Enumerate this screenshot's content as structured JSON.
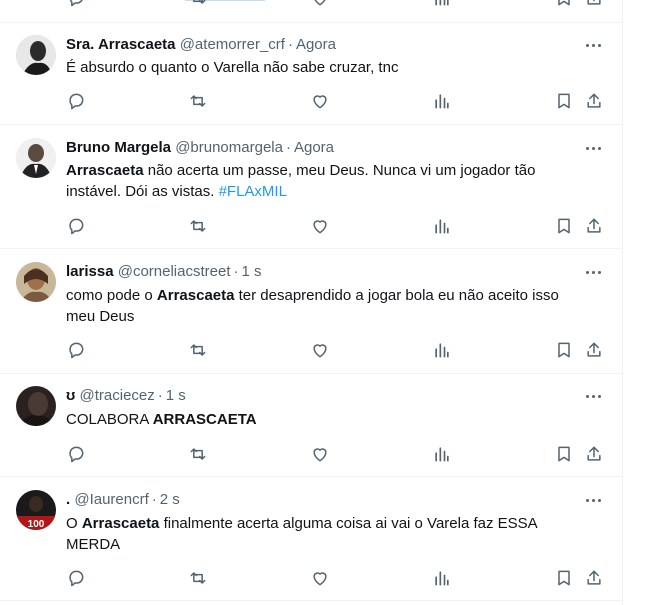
{
  "tweets": [
    {
      "name": "Sra. Arrascaeta",
      "handle": "@atemorrer_crf",
      "time": "Agora",
      "text_parts": [
        {
          "text": "É absurdo o quanto o Varella não sabe cruzar, tnc",
          "style": "normal"
        }
      ]
    },
    {
      "name": "Bruno Margela",
      "handle": "@brunomargela",
      "time": "Agora",
      "text_parts": [
        {
          "text": "Arrascaeta",
          "style": "bold"
        },
        {
          "text": " não acerta um passe, meu Deus. Nunca vi um jogador tão",
          "style": "normal"
        },
        {
          "text": "instável. Dói as vistas. ",
          "style": "normal"
        },
        {
          "text": "#FLAxMIL",
          "style": "hashtag"
        }
      ]
    },
    {
      "name": "larissa",
      "handle": "@corneliacstreet",
      "time": "1 s",
      "text_parts": [
        {
          "text": "como pode o ",
          "style": "normal"
        },
        {
          "text": "Arrascaeta",
          "style": "bold"
        },
        {
          "text": " ter desaprendido a jogar bola eu não aceito isso",
          "style": "normal"
        },
        {
          "text": "meu Deus",
          "style": "normal"
        }
      ]
    },
    {
      "name": "ʊ",
      "handle": "@traciecez",
      "time": "1 s",
      "text_parts": [
        {
          "text": "COLABORA ",
          "style": "normal"
        },
        {
          "text": "ARRASCAETA",
          "style": "bold"
        }
      ]
    },
    {
      "name": ".",
      "handle": "@Iaurencrf",
      "time": "2 s",
      "text_parts": [
        {
          "text": "O ",
          "style": "normal"
        },
        {
          "text": "Arrascaeta",
          "style": "bold"
        },
        {
          "text": " finalmente acerta alguma coisa ai vai o Varela faz ESSA",
          "style": "normal"
        },
        {
          "text": "MERDA",
          "style": "normal"
        }
      ]
    }
  ],
  "colors": {
    "text": "#0f1419",
    "secondary": "#536471",
    "link": "#1d9bf0",
    "divider": "#eff3f4"
  },
  "icons": [
    "reply-icon",
    "retweet-icon",
    "like-icon",
    "views-icon",
    "bookmark-icon",
    "share-icon",
    "more-icon"
  ]
}
